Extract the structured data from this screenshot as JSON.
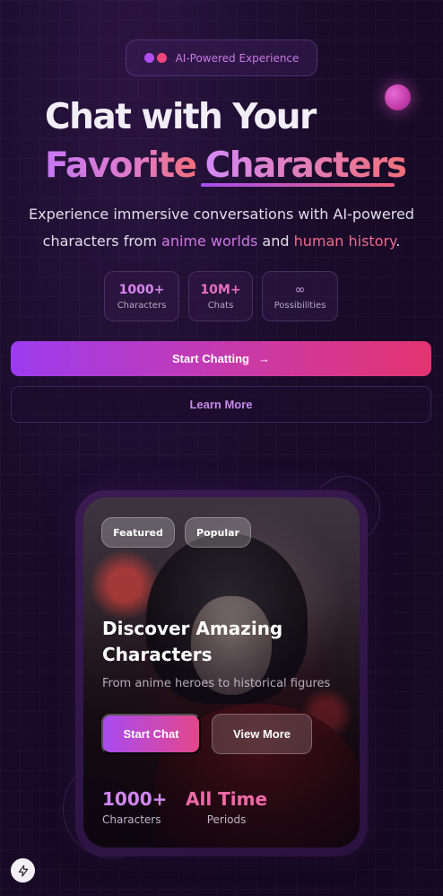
{
  "badge": {
    "text": "AI-Powered Experience"
  },
  "hero": {
    "line1": "Chat with Your",
    "line2_part1": "Favorite",
    "line2_part2": "Characters",
    "sub_before": "Experience immersive conversations with AI-powered characters from ",
    "sub_hl1": "anime worlds",
    "sub_mid": " and ",
    "sub_hl2": "human history",
    "sub_after": "."
  },
  "stats": [
    {
      "value": "1000+",
      "label": "Characters"
    },
    {
      "value": "10M+",
      "label": "Chats"
    },
    {
      "value": "∞",
      "label": "Possibilities"
    }
  ],
  "actions": {
    "start_label": "Start Chatting",
    "start_arrow": "→",
    "learn_label": "Learn More"
  },
  "card": {
    "tags": [
      "Featured",
      "Popular"
    ],
    "title": "Discover Amazing Characters",
    "subtitle": "From anime heroes to historical figures",
    "primary_label": "Start Chat",
    "secondary_label": "View More",
    "stats": [
      {
        "value": "1000+",
        "label": "Characters"
      },
      {
        "value": "All Time",
        "label": "Periods"
      }
    ]
  },
  "icons": {
    "fab": "bolt-icon",
    "arrow": "arrow-right-icon"
  },
  "colors": {
    "accent_purple": "#a64ef0",
    "accent_pink": "#e33370"
  }
}
